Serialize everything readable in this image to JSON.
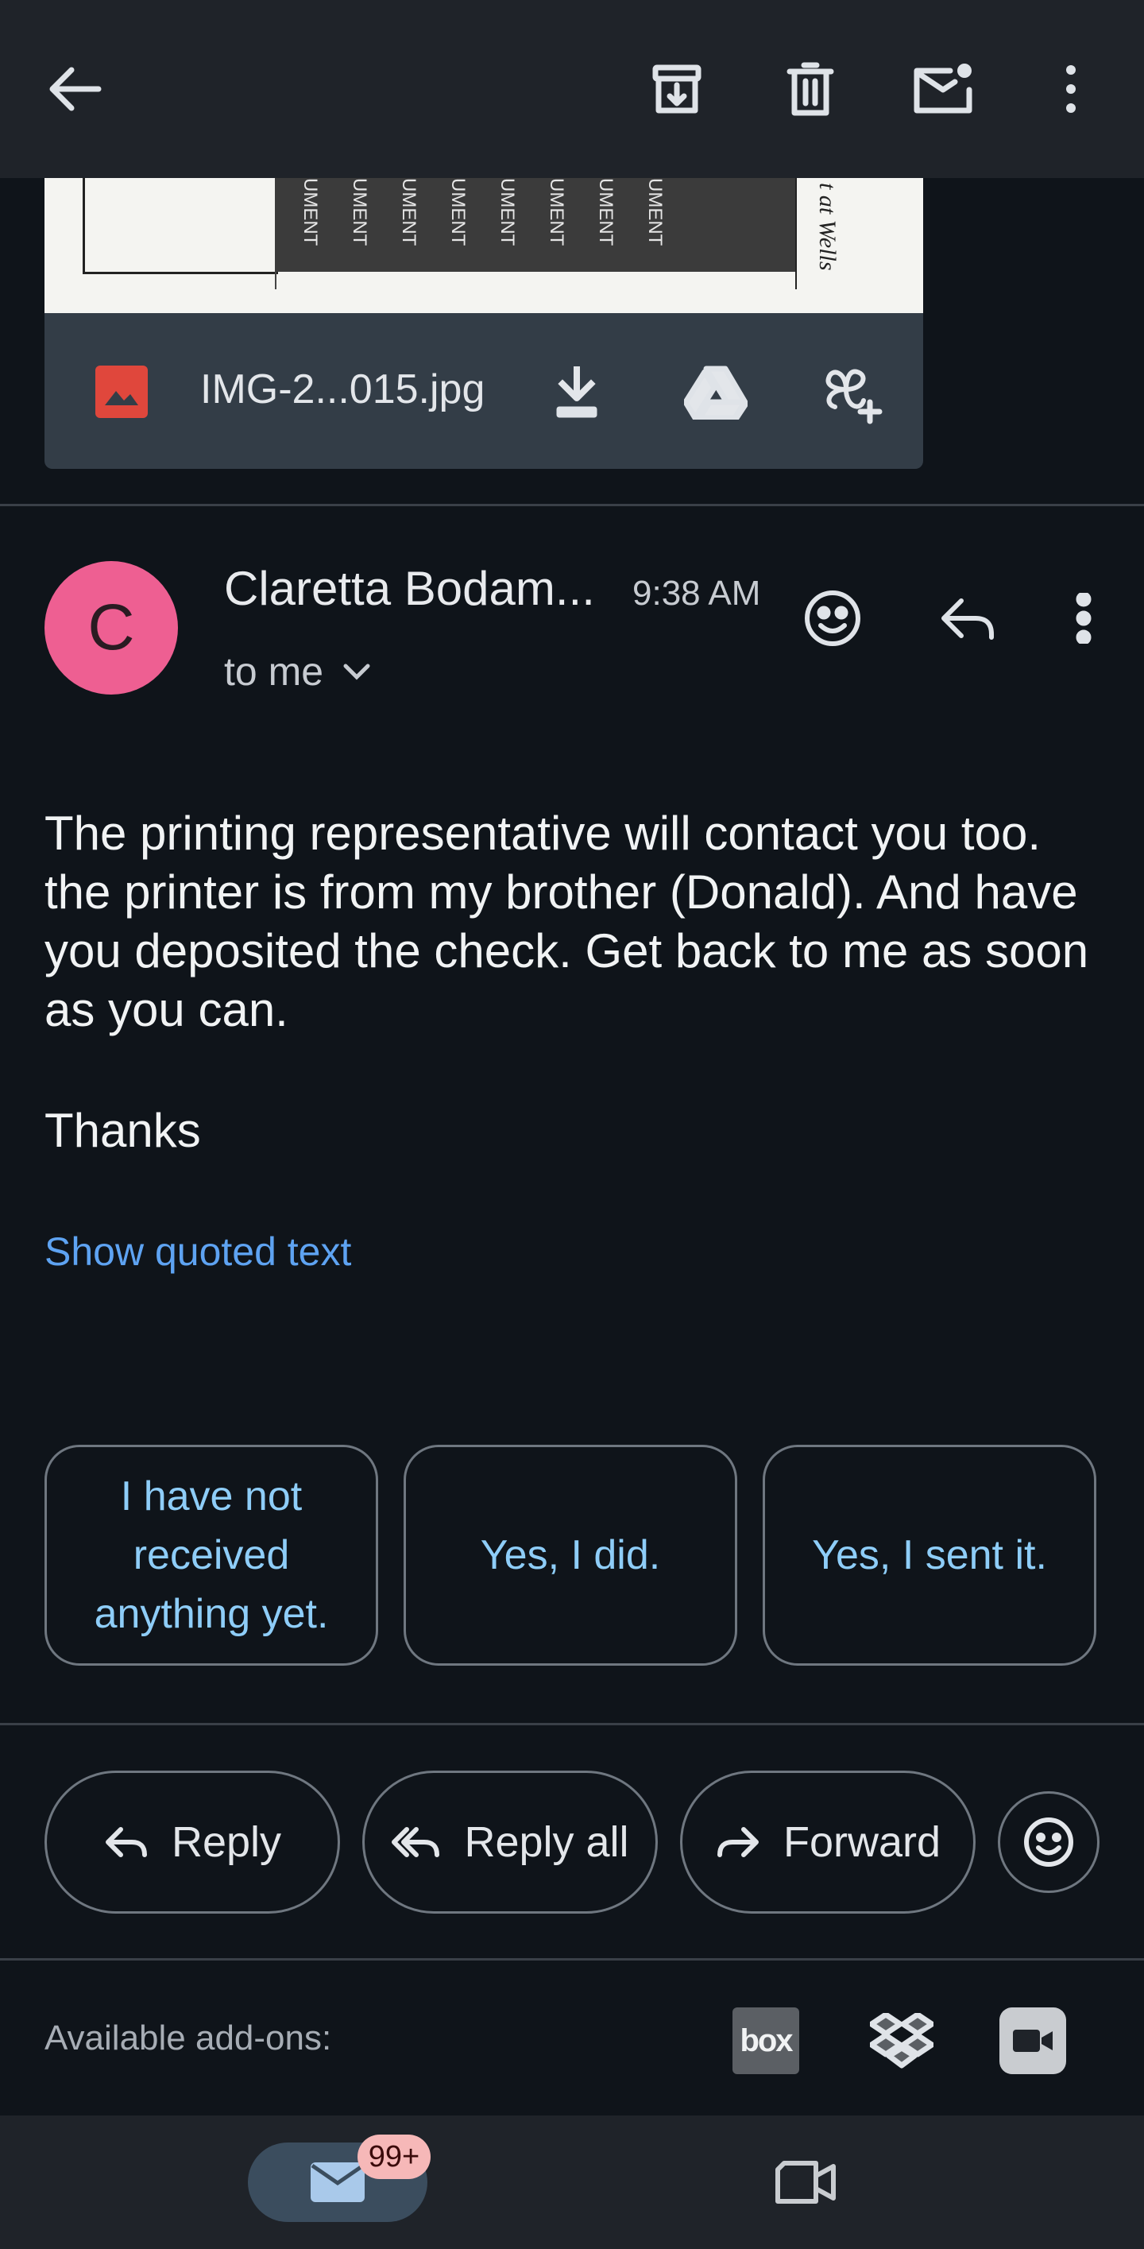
{
  "toolbar": {
    "back": "back-arrow-icon",
    "archive": "archive-icon",
    "delete": "trash-icon",
    "mark_unread": "mark-unread-icon",
    "more": "more-vert-icon"
  },
  "attachment": {
    "filename": "IMG-2...015.jpg",
    "preview_texts": [
      "UMENT",
      "UMENT",
      "UMENT",
      "UMENT",
      "UMENT",
      "UMENT",
      "UMENT",
      "UMENT",
      "t at Wells"
    ]
  },
  "message": {
    "sender_initial": "C",
    "sender_name": "Claretta Bodam...",
    "time": "9:38 AM",
    "recipient": "to me",
    "body": "The printing representative will contact you too. the printer is from my brother (Donald). And have you deposited the check. Get back to me as soon as you can.",
    "signoff": "Thanks",
    "show_quoted": "Show quoted text"
  },
  "smart_replies": [
    "I have not received anything yet.",
    "Yes, I did.",
    "Yes, I sent it."
  ],
  "actions": {
    "reply": "Reply",
    "reply_all": "Reply all",
    "forward": "Forward"
  },
  "addons": {
    "label": "Available add-ons:",
    "box_label": "box"
  },
  "bottom_nav": {
    "mail_badge": "99+"
  },
  "colors": {
    "avatar": "#ee5f92",
    "link": "#5ea3f2",
    "smart_reply_text": "#8ecdf8"
  }
}
